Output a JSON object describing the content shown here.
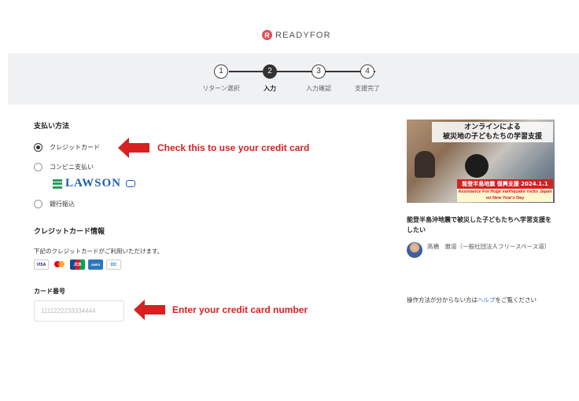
{
  "brand": {
    "logo_mark": "R",
    "name": "READYFOR"
  },
  "steps": [
    {
      "number": "1",
      "label": "リターン選択",
      "active": false
    },
    {
      "number": "2",
      "label": "入力",
      "active": true
    },
    {
      "number": "3",
      "label": "入力確認",
      "active": false
    },
    {
      "number": "4",
      "label": "支援完了",
      "active": false
    }
  ],
  "payment": {
    "section_title": "支払い方法",
    "options": [
      {
        "label": "クレジットカード",
        "selected": true
      },
      {
        "label": "コンビニ支払い",
        "selected": false
      },
      {
        "label": "銀行振込",
        "selected": false
      }
    ],
    "convenience_store_logo": "LAWSON"
  },
  "credit_card": {
    "section_title": "クレジットカード情報",
    "accepted_text": "下記のクレジットカードがご利用いただけます。",
    "brands": [
      "VISA",
      "Mastercard",
      "JCB",
      "AMEX",
      "Diners Club"
    ],
    "brand_marks": {
      "visa": "VISA",
      "jcb": "JCB",
      "amex": "AMEX",
      "diners": "DC"
    },
    "number_label": "カード番号",
    "number_placeholder": "1111222233334444"
  },
  "annotations": {
    "radio_hint": "Check this to use your credit card",
    "input_hint": "Enter your credit card number",
    "color": "#d82020"
  },
  "project": {
    "image_caption_line1": "オンラインによる",
    "image_caption_line2": "被災地の子どもたちの学習支援",
    "image_band": "能登半島地震 復興支援 2024.1.1",
    "image_band_sub": "Assistance For Huge earthquake rocks Japan on New Year's Day",
    "title": "能登半島沖地震で被災した子どもたちへ学習支援をしたい",
    "owner": "高橋　雅道（一般社団法人フリースペース道）"
  },
  "help": {
    "prefix": "操作方法が分からない方は",
    "link": "ヘルプ",
    "suffix": "をご覧ください"
  }
}
